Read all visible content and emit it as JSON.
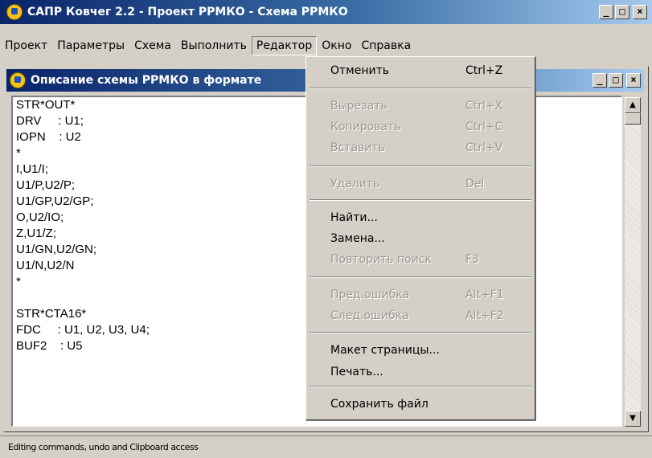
{
  "window": {
    "title": "САПР Ковчег 2.2 - Проект РРМКО - Схема РРМКО",
    "minimize": "_",
    "maximize": "□",
    "close": "×"
  },
  "menubar": [
    "Проект",
    "Параметры",
    "Схема",
    "Выполнить",
    "Редактор",
    "Окно",
    "Справка"
  ],
  "child_window": {
    "title": "Описание схемы РРМКО в формате"
  },
  "editor_lines": [
    "STR*OUT*",
    "DRV     : U1;",
    "IOPN    : U2",
    "*",
    "I,U1/I;",
    "U1/P,U2/P;",
    "U1/GP,U2/GP;",
    "O,U2/IO;",
    "Z,U1/Z;",
    "U1/GN,U2/GN;",
    "U1/N,U2/N",
    "*",
    "",
    "STR*CTA16*",
    "FDC     : U1, U2, U3, U4;",
    "BUF2    : U5"
  ],
  "dropdown": {
    "items": [
      {
        "label": "Отменить",
        "shortcut": "Ctrl+Z",
        "disabled": false
      },
      {
        "label": "Вырезать",
        "shortcut": "Ctrl+X",
        "disabled": true
      },
      {
        "label": "Копировать",
        "shortcut": "Ctrl+C",
        "disabled": true
      },
      {
        "label": "Вставить",
        "shortcut": "Ctrl+V",
        "disabled": true
      },
      {
        "label": "Удалить",
        "shortcut": "Del",
        "disabled": true
      },
      {
        "label": "Найти...",
        "shortcut": "",
        "disabled": false
      },
      {
        "label": "Замена...",
        "shortcut": "",
        "disabled": false
      },
      {
        "label": "Повторить поиск",
        "shortcut": "F3",
        "disabled": true
      },
      {
        "label": "Пред.ошибка",
        "shortcut": "Alt+F1",
        "disabled": true
      },
      {
        "label": "След.ошибка",
        "shortcut": "Alt+F2",
        "disabled": true
      },
      {
        "label": "Макет страницы...",
        "shortcut": "",
        "disabled": false
      },
      {
        "label": "Печать...",
        "shortcut": "",
        "disabled": false
      },
      {
        "label": "Сохранить файл",
        "shortcut": "",
        "disabled": false
      }
    ]
  },
  "scrollbar": {
    "up": "▲",
    "down": "▼"
  },
  "statusbar": {
    "text": "Editing commands, undo and Clipboard access"
  }
}
